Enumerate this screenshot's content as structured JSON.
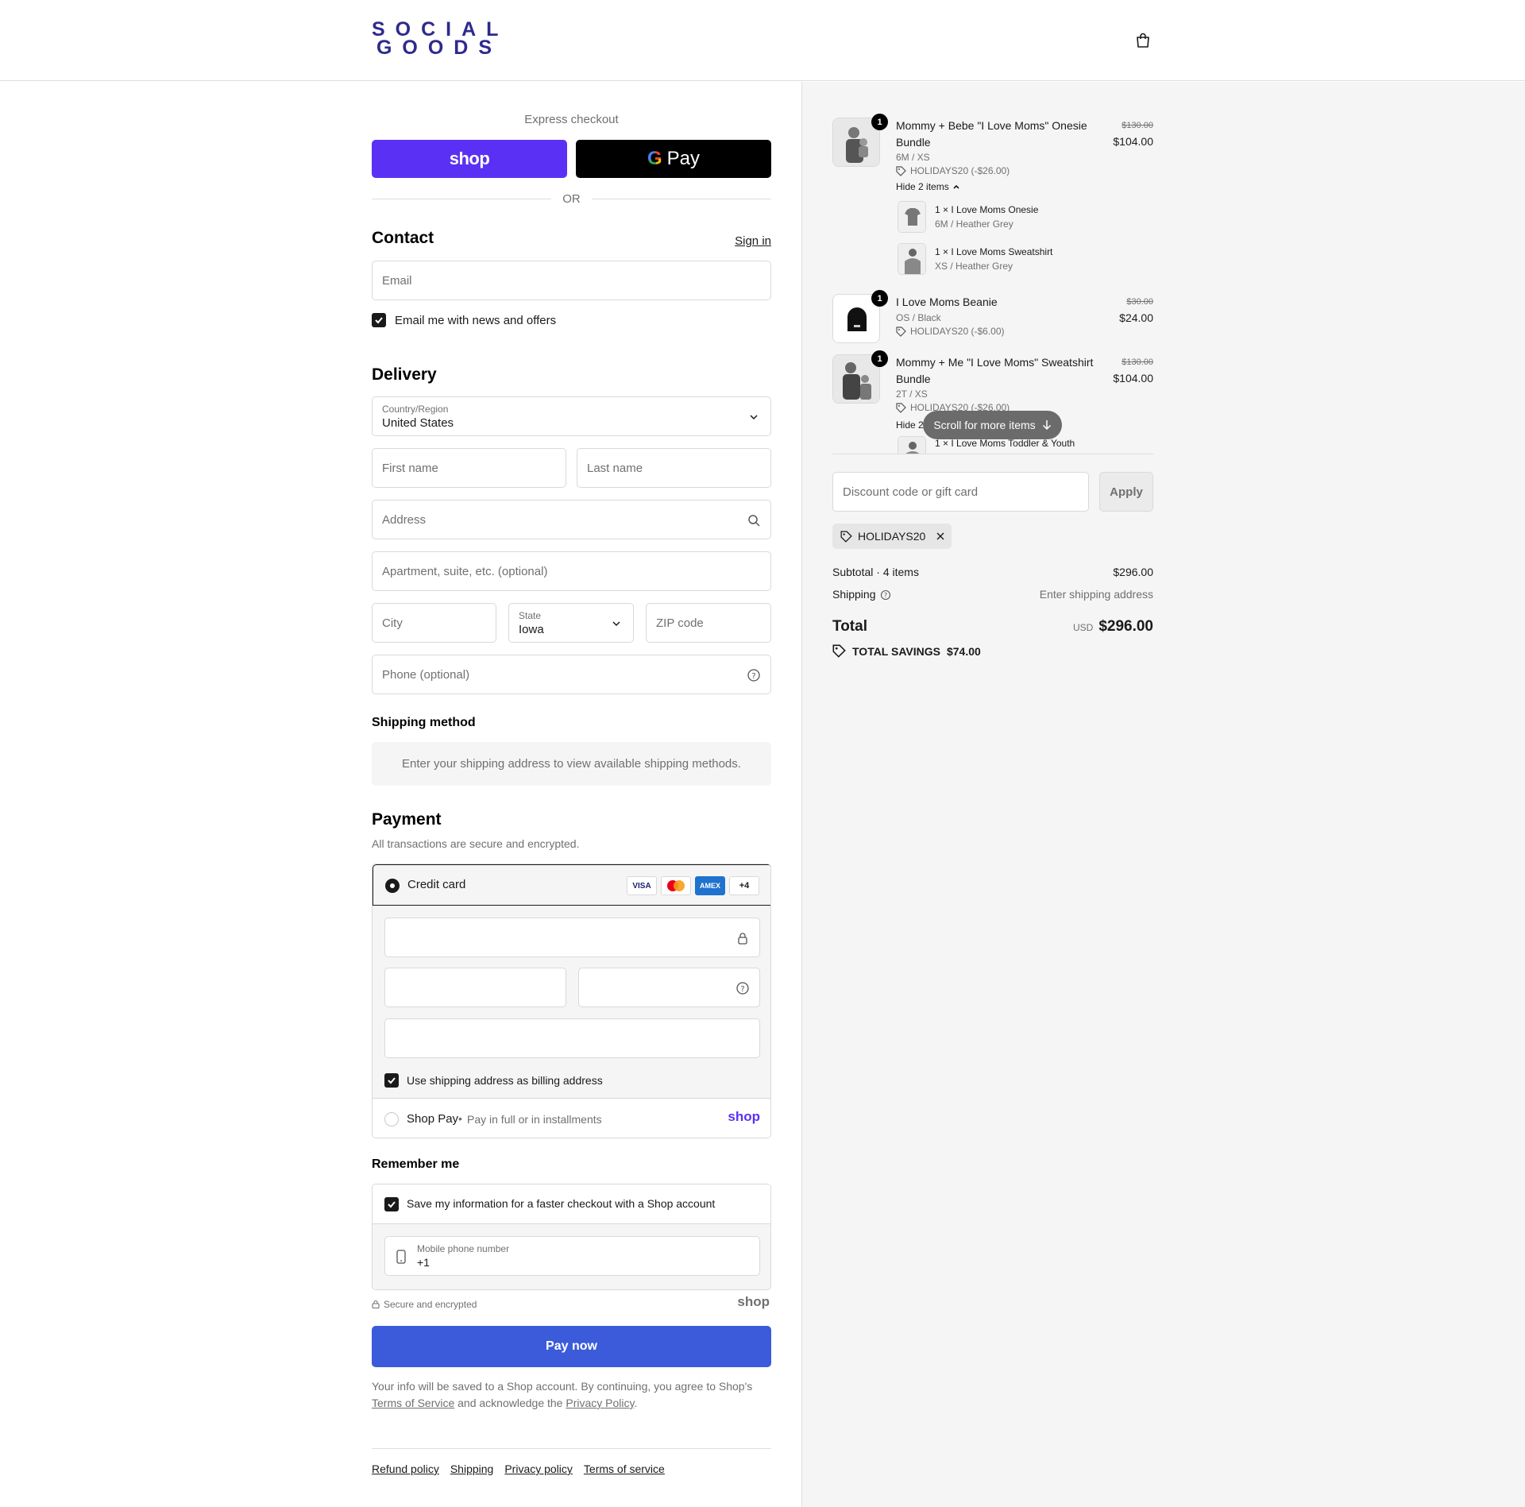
{
  "header": {
    "logo_line1": "SOCIAL",
    "logo_line2": "GOODS",
    "brand_color": "#2e2a8c"
  },
  "express": {
    "label": "Express checkout",
    "shop_pay_label": "shop",
    "gpay_g": "G",
    "gpay_label": "Pay",
    "or": "OR"
  },
  "contact": {
    "title": "Contact",
    "sign_in": "Sign in",
    "email_placeholder": "Email",
    "newsletter_label": "Email me with news and offers",
    "newsletter_checked": true
  },
  "delivery": {
    "title": "Delivery",
    "country_label": "Country/Region",
    "country_value": "United States",
    "first_name": "First name",
    "last_name": "Last name",
    "address": "Address",
    "apartment": "Apartment, suite, etc. (optional)",
    "city": "City",
    "state_label": "State",
    "state_value": "Iowa",
    "zip": "ZIP code",
    "phone": "Phone (optional)"
  },
  "shipping_method": {
    "title": "Shipping method",
    "note": "Enter your shipping address to view available shipping methods."
  },
  "payment": {
    "title": "Payment",
    "subtitle": "All transactions are secure and encrypted.",
    "credit_card": "Credit card",
    "badges": [
      "VISA",
      "",
      "AMEX",
      "+4"
    ],
    "billing_label": "Use shipping address as billing address",
    "shop_pay": "Shop Pay",
    "shop_pay_sub": "Pay in full or in installments",
    "shop_logo": "shop"
  },
  "remember": {
    "title": "Remember me",
    "save_label": "Save my information for a faster checkout with a Shop account",
    "mobile_label": "Mobile phone number",
    "mobile_value": "+1",
    "secure": "Secure and encrypted",
    "shop_logo": "shop"
  },
  "pay_now": "Pay now",
  "consent": {
    "text1": "Your info will be saved to a Shop account. By continuing, you agree to Shop's",
    "tos": "Terms of Service",
    "text2": "and acknowledge the",
    "privacy": "Privacy Policy",
    "end": "."
  },
  "footer": [
    "Refund policy",
    "Shipping",
    "Privacy policy",
    "Terms of service"
  ],
  "order": {
    "items": [
      {
        "qty": "1",
        "name": "Mommy + Bebe \"I Love Moms\" Onesie Bundle",
        "variant": "6M / XS",
        "discount": "HOLIDAYS20 (-$26.00)",
        "old_price": "$130.00",
        "price": "$104.00",
        "hide": "Hide 2 items",
        "sub_items": [
          {
            "name": "1 × I Love Moms Onesie",
            "variant": "6M / Heather Grey"
          },
          {
            "name": "1 × I Love Moms Sweatshirt",
            "variant": "XS / Heather Grey"
          }
        ]
      },
      {
        "qty": "1",
        "name": "I Love Moms Beanie",
        "variant": "OS / Black",
        "discount": "HOLIDAYS20 (-$6.00)",
        "old_price": "$30.00",
        "price": "$24.00"
      },
      {
        "qty": "1",
        "name": "Mommy + Me \"I Love Moms\" Sweatshirt Bundle",
        "variant": "2T / XS",
        "discount": "HOLIDAYS20 (-$26.00)",
        "old_price": "$130.00",
        "price": "$104.00",
        "hide": "Hide 2",
        "sub_items": [
          {
            "name": "1 × I Love Moms Toddler & Youth"
          }
        ]
      }
    ],
    "scroll_hint": "Scroll for more items",
    "discount_placeholder": "Discount code or gift card",
    "apply": "Apply",
    "applied_code": "HOLIDAYS20",
    "subtotal_label": "Subtotal · 4 items",
    "subtotal_value": "$296.00",
    "shipping_label": "Shipping",
    "shipping_value": "Enter shipping address",
    "total_label": "Total",
    "currency": "USD",
    "total_value": "$296.00",
    "savings_label": "TOTAL SAVINGS",
    "savings_value": "$74.00"
  }
}
